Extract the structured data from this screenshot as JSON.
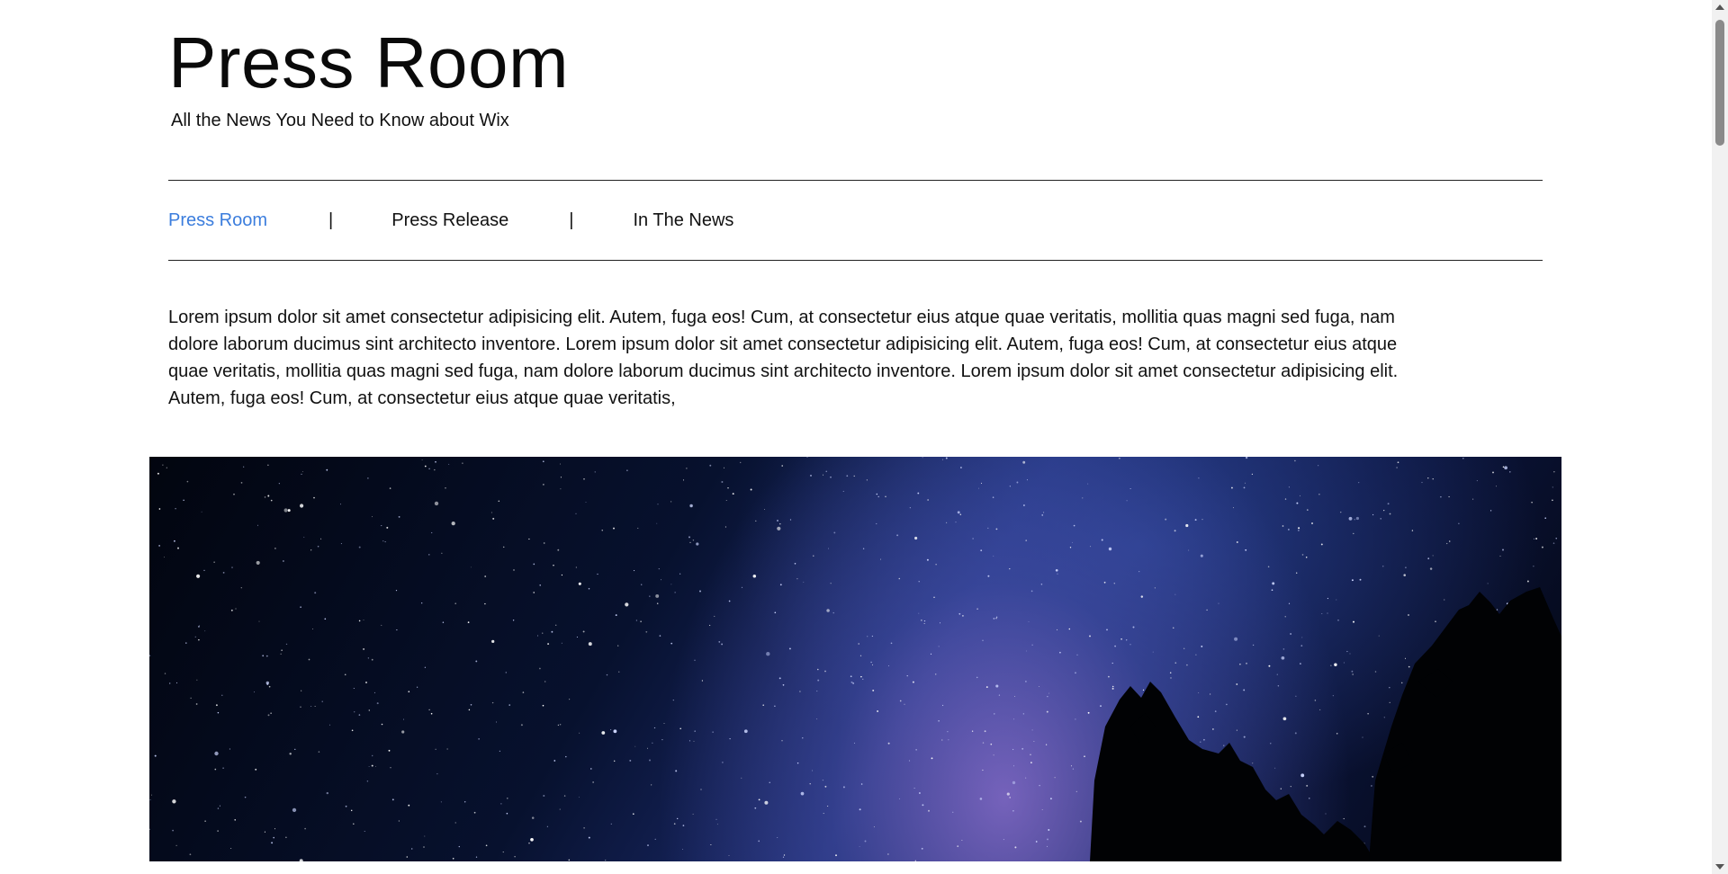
{
  "header": {
    "title": "Press Room",
    "subtitle": "All the News You Need to Know about Wix"
  },
  "nav": {
    "items": [
      {
        "label": "Press Room",
        "active": true
      },
      {
        "label": "Press Release",
        "active": false
      },
      {
        "label": "In The News",
        "active": false
      }
    ],
    "separator": "|"
  },
  "intro": {
    "text": "Lorem ipsum dolor sit amet consectetur adipisicing elit. Autem, fuga eos! Cum, at consectetur eius atque quae veritatis, mollitia quas magni sed fuga, nam dolore laborum ducimus sint architecto inventore. Lorem ipsum dolor sit amet consectetur adipisicing elit. Autem, fuga eos! Cum, at consectetur eius atque quae veritatis, mollitia quas magni sed fuga, nam dolore laborum ducimus sint architecto inventore. Lorem ipsum dolor sit amet consectetur adipisicing elit. Autem, fuga eos! Cum, at consectetur eius atque quae veritatis,"
  },
  "hero_image": {
    "subject": "starry night sky with milky way and tree silhouettes"
  },
  "colors": {
    "accent": "#3b7ddd",
    "text": "#111111",
    "rule": "#222222"
  }
}
